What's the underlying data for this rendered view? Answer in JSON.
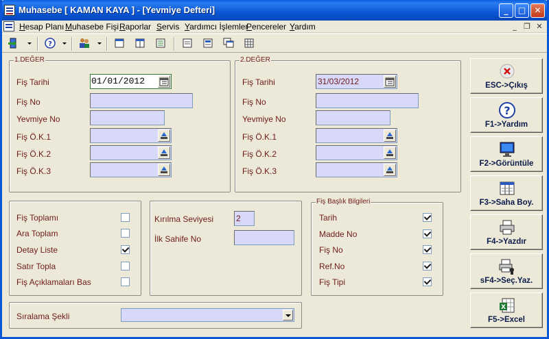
{
  "window": {
    "title": "Muhasebe [ KAMAN KAYA ]  - [Yevmiye Defteri]",
    "controls": {
      "minimize": "_",
      "maximize": "□",
      "close": "✕"
    }
  },
  "menu": {
    "items": [
      "Hesap Planı",
      "Muhasebe Fişi",
      "Raporlar",
      "Servis",
      "Yardımcı İşlemler",
      "Pencereler",
      "Yardım"
    ],
    "mdi_controls": {
      "minimize": "_",
      "restore": "❐",
      "close": "✕"
    }
  },
  "group1": {
    "legend": "1.DEĞER",
    "fis_tarihi_label": "Fiş Tarihi",
    "fis_tarihi_value": "01/01/2012",
    "fis_no_label": "Fiş No",
    "yevmiye_no_label": "Yevmiye No",
    "fis_ok1_label": "Fiş Ö.K.1",
    "fis_ok2_label": "Fiş Ö.K.2",
    "fis_ok3_label": "Fiş Ö.K.3"
  },
  "group2": {
    "legend": "2.DEĞER",
    "fis_tarihi_label": "Fiş Tarihi",
    "fis_tarihi_value": "31/03/2012",
    "fis_no_label": "Fiş No",
    "yevmiye_no_label": "Yevmiye No",
    "fis_ok1_label": "Fiş Ö.K.1",
    "fis_ok2_label": "Fiş Ö.K.2",
    "fis_ok3_label": "Fiş Ö.K.3"
  },
  "options": {
    "items": [
      {
        "label": "Fiş Toplamı",
        "checked": false
      },
      {
        "label": "Ara Toplam",
        "checked": false
      },
      {
        "label": "Detay Liste",
        "checked": true
      },
      {
        "label": "Satır Topla",
        "checked": false
      },
      {
        "label": "Fiş Açıklamaları Bas",
        "checked": false
      }
    ]
  },
  "levels": {
    "kirilma_label": "Kırılma Seviyesi",
    "kirilma_value": "2",
    "ilk_sahife_label": "İlk Sahife No",
    "ilk_sahife_value": ""
  },
  "header_info": {
    "legend": "Fiş Başlık Bilgileri",
    "items": [
      {
        "label": "Tarih",
        "checked": true
      },
      {
        "label": "Madde No",
        "checked": true
      },
      {
        "label": "Fiş No",
        "checked": true
      },
      {
        "label": "Ref.No",
        "checked": true
      },
      {
        "label": "Fiş Tipi",
        "checked": true
      }
    ]
  },
  "sort": {
    "label": "Sıralama Şekli",
    "value": ""
  },
  "actions": [
    {
      "label": "ESC->Çıkış",
      "icon": "exit-x-icon"
    },
    {
      "label": "F1->Yardım",
      "icon": "help-question-icon"
    },
    {
      "label": "F2->Görüntüle",
      "icon": "monitor-icon"
    },
    {
      "label": "F3->Saha Boy.",
      "icon": "field-size-icon"
    },
    {
      "label": "F4->Yazdır",
      "icon": "printer-icon"
    },
    {
      "label": "sF4->Seç.Yaz.",
      "icon": "printer-select-icon"
    },
    {
      "label": "F5->Excel",
      "icon": "excel-icon"
    }
  ],
  "colors": {
    "label": "#6e1a1a",
    "field_bg": "#d8d8f8",
    "titlebar": "#0a56d6",
    "button_caption": "#0a1a4a"
  }
}
